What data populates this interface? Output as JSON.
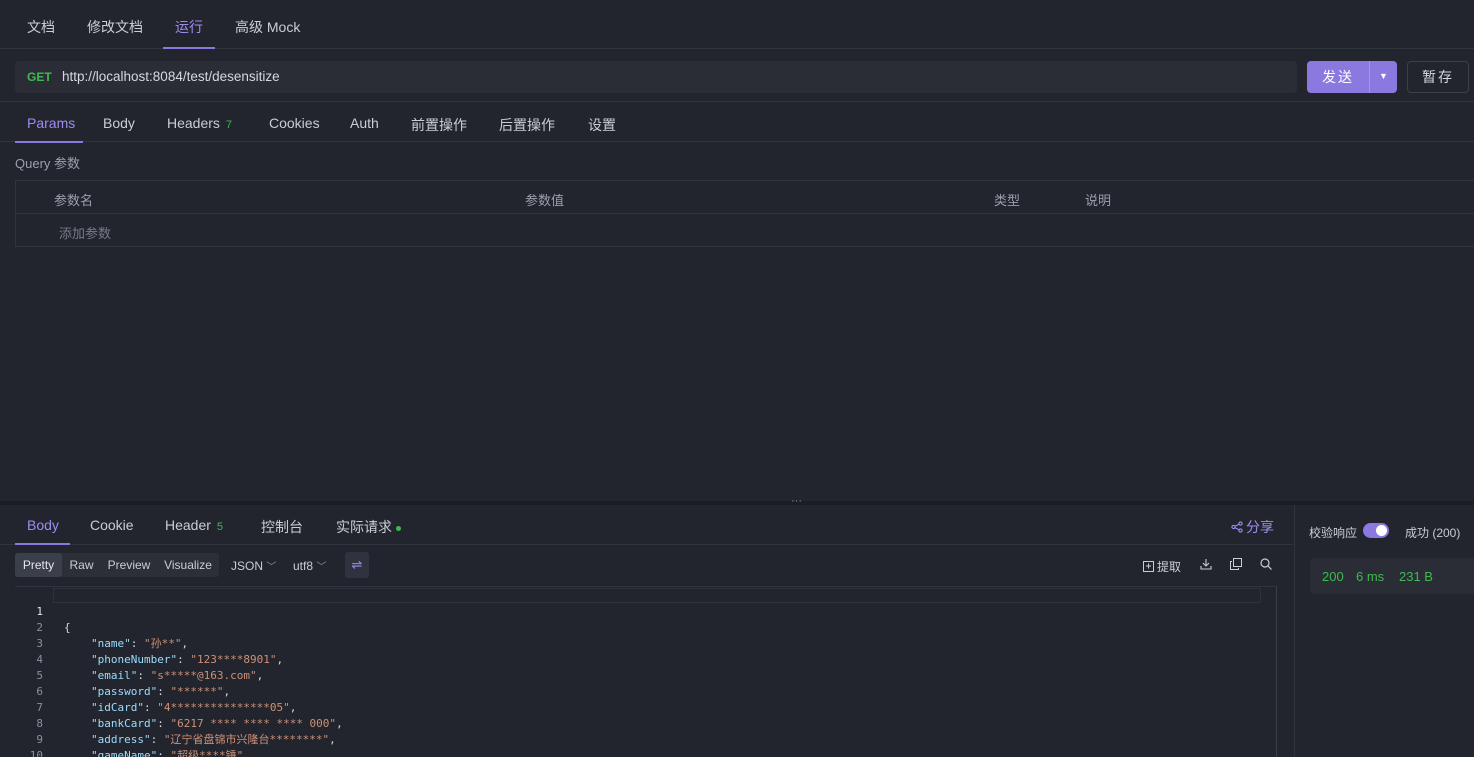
{
  "top_tabs": [
    {
      "label": "文档",
      "active": false
    },
    {
      "label": "修改文档",
      "active": false
    },
    {
      "label": "运行",
      "active": true
    },
    {
      "label": "高级 Mock",
      "active": false
    }
  ],
  "request": {
    "method": "GET",
    "url": "http://localhost:8084/test/desensitize",
    "send_label": "发送",
    "save_label": "暂存"
  },
  "req_tabs": [
    {
      "label": "Params",
      "active": true
    },
    {
      "label": "Body"
    },
    {
      "label": "Headers",
      "badge": "7"
    },
    {
      "label": "Cookies"
    },
    {
      "label": "Auth"
    },
    {
      "label": "前置操作"
    },
    {
      "label": "后置操作"
    },
    {
      "label": "设置"
    }
  ],
  "query": {
    "title": "Query 参数",
    "columns": [
      "参数名",
      "参数值",
      "类型",
      "说明"
    ],
    "add_placeholder": "添加参数"
  },
  "resp_tabs": [
    {
      "label": "Body",
      "active": true
    },
    {
      "label": "Cookie"
    },
    {
      "label": "Header",
      "badge": "5"
    },
    {
      "label": "控制台"
    },
    {
      "label": "实际请求"
    }
  ],
  "share_label": "分享",
  "format": {
    "modes": [
      "Pretty",
      "Raw",
      "Preview",
      "Visualize"
    ],
    "active_mode": "Pretty",
    "language": "JSON",
    "encoding": "utf8"
  },
  "tools": {
    "extract_label": "提取"
  },
  "code_lines": [
    {
      "n": "1",
      "text": "{"
    },
    {
      "n": "2",
      "key": "\"name\"",
      "value": "\"孙**\""
    },
    {
      "n": "3",
      "key": "\"phoneNumber\"",
      "value": "\"123****8901\""
    },
    {
      "n": "4",
      "key": "\"email\"",
      "value": "\"s*****@163.com\""
    },
    {
      "n": "5",
      "key": "\"password\"",
      "value": "\"******\""
    },
    {
      "n": "6",
      "key": "\"idCard\"",
      "value": "\"4***************05\""
    },
    {
      "n": "7",
      "key": "\"bankCard\"",
      "value": "\"6217 **** **** **** 000\""
    },
    {
      "n": "8",
      "key": "\"address\"",
      "value": "\"辽宁省盘锦市兴隆台********\""
    },
    {
      "n": "9",
      "key": "\"gameName\"",
      "value": "\"超级****锤\""
    },
    {
      "n": "10",
      "text": "}"
    }
  ],
  "response_meta": {
    "verify_label": "校验响应",
    "verify_enabled": true,
    "success_label": "成功 (200)",
    "status": "200",
    "time": "6 ms",
    "size": "231 B"
  },
  "colors": {
    "accent": "#8b79e0",
    "success": "#3fb950",
    "background": "#22252d"
  }
}
